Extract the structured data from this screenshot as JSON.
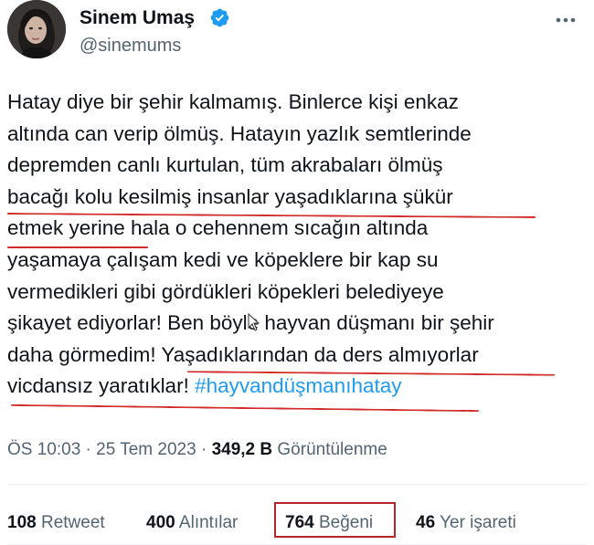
{
  "author": {
    "display_name": "Sinem Umaş",
    "handle": "@sinemums",
    "verified": true,
    "badge_color": "#1d9bf0"
  },
  "more_icon": "ellipsis-icon",
  "tweet": {
    "lines": [
      "Hatay diye bir şehir kalmamış. Binlerce kişi enkaz",
      "altında can verip ölmüş. Hatayın yazlık semtlerinde",
      "depremden canlı kurtulan, tüm akrabaları ölmüş",
      "bacağı kolu kesilmiş insanlar yaşadıklarına şükür",
      "etmek yerine hala o cehennem sıcağın altında",
      "yaşamaya çalışam kedi ve köpeklere bir kap su",
      "vermedikleri gibi gördükleri köpekleri belediyeye",
      "şikayet ediyorlar! Ben böyle hayvan düşmanı bir şehir",
      "daha görmedim! Yaşadıklarından da ders almıyorlar"
    ],
    "last_line_text": "vicdansız yaratıklar! ",
    "hashtag": "#hayvandüşmanıhatay",
    "hashtag_color": "#1d9bf0",
    "underline_color": "#d32a2a"
  },
  "meta": {
    "time": "ÖS 10:03",
    "separator": " · ",
    "date": "25 Tem 2023",
    "views_count": "349,2 B",
    "views_label": " Görüntülenme"
  },
  "stats": {
    "retweets": {
      "count": "108",
      "label": " Retweet"
    },
    "quotes": {
      "count": "400",
      "label": " Alıntılar"
    },
    "likes": {
      "count": "764",
      "label": " Beğeni"
    },
    "bookmarks": {
      "count": "46",
      "label": " Yer işareti"
    },
    "highlight_color": "#b5262c"
  }
}
